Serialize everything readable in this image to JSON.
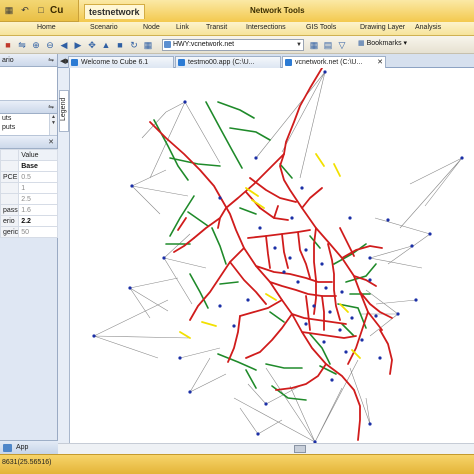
{
  "window": {
    "app_title": "Cu",
    "context_tab_title": "testnetwork",
    "context_group_label": "Network Tools"
  },
  "ribbon": {
    "tabs": [
      "Home",
      "Scenario",
      "Node",
      "Link",
      "Transit",
      "Intersections",
      "GIS Tools",
      "Drawing Layer",
      "Analysis"
    ]
  },
  "toolbar": {
    "address_value": "HWY:vcnetwork.net",
    "bookmarks_label": "Bookmarks"
  },
  "left_panel": {
    "header_label": "ario",
    "list_items": [
      "uts",
      "puts"
    ],
    "grid_header": {
      "key": "",
      "value": "Value"
    },
    "rows": [
      {
        "key": "",
        "value": "Base"
      },
      {
        "key": "PCE",
        "value": "0.5"
      },
      {
        "key": "",
        "value": "1"
      },
      {
        "key": "",
        "value": "2.5"
      },
      {
        "key": "pass",
        "value": "1.6"
      },
      {
        "key": "erio",
        "value": "2.2"
      },
      {
        "key": "geric",
        "value": "50"
      }
    ],
    "bottom_label": "App"
  },
  "legend": {
    "label": "Legend"
  },
  "doc_tabs": [
    {
      "label": "Welcome to Cube 6.1"
    },
    {
      "label": "testmo00.app (C:\\U..."
    },
    {
      "label": "vcnetwork.net (C:\\U..."
    }
  ],
  "status": {
    "coordinates": "8631(25.56516)"
  },
  "colors": {
    "road_red": "#d01c1c",
    "road_green": "#1f8a2a",
    "road_yellow": "#f2e000",
    "connector_gray": "#8a8a8a",
    "centroid_blue": "#1b2fa6",
    "ribbon_gold": "#f3c94e"
  }
}
